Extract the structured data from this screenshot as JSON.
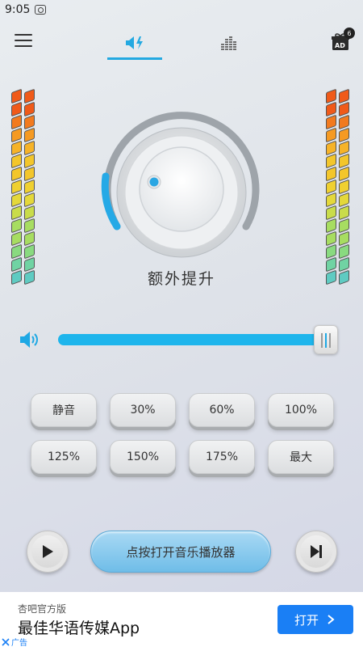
{
  "status_bar": {
    "time": "9:05"
  },
  "header": {
    "gift_badge": "6",
    "gift_label": "AD",
    "accent": "#23a9e1"
  },
  "knob": {
    "label": "额外提升",
    "arc_color": "#25a9e6"
  },
  "volume": {
    "level": 0.96
  },
  "presets": [
    {
      "label": "静音"
    },
    {
      "label": "30%"
    },
    {
      "label": "60%"
    },
    {
      "label": "100%"
    },
    {
      "label": "125%"
    },
    {
      "label": "150%"
    },
    {
      "label": "175%"
    },
    {
      "label": "最大"
    }
  ],
  "player": {
    "open_label": "点按打开音乐播放器"
  },
  "ad": {
    "source": "杏吧官方版",
    "title": "最佳华语传媒App",
    "cta_label": "打开",
    "tag_label": "广告"
  },
  "meter_colors": [
    "#f05a19",
    "#f27a1e",
    "#f59a22",
    "#f6b328",
    "#f3c62b",
    "#efd031",
    "#e4d83a",
    "#c9dc4a",
    "#a7dd61",
    "#89da80",
    "#70d3a3",
    "#5fcbc2"
  ]
}
